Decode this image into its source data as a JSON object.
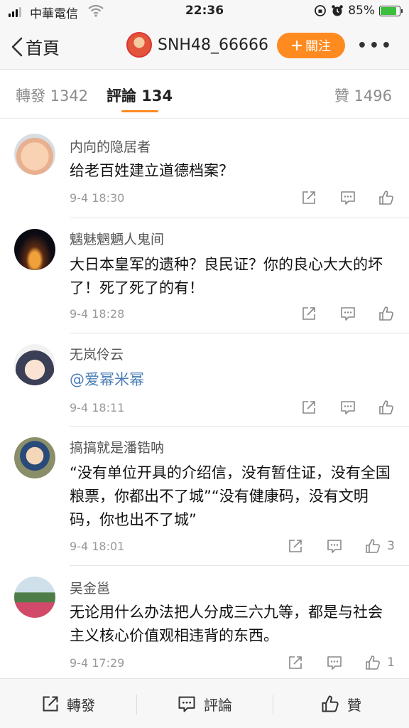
{
  "status_bar": {
    "carrier": "中華電信",
    "time": "22:36",
    "battery": "85%",
    "battery_level": 0.85
  },
  "nav": {
    "back_label": "首頁",
    "username": "SNH48_66666",
    "follow_label": "關注",
    "more_label": "•••"
  },
  "tabs": {
    "repost": "轉發 1342",
    "comments": "評論 134",
    "likes": "贊 1496"
  },
  "comments": [
    {
      "name": "内向的隐居者",
      "text": "给老百姓建立道德档案？",
      "time": "9-4 18:30",
      "likes": "",
      "avatar": "baby-avatar"
    },
    {
      "name": "魑魅魍魉人鬼间",
      "text": "大日本皇军的遗种？良民证？你的良心大大的坏了！死了死了的有！",
      "time": "9-4 18:28",
      "likes": "",
      "avatar": "night-fountain-avatar"
    },
    {
      "name": "无岚伶云",
      "text": "@爱幂米幂",
      "time": "9-4 18:11",
      "likes": "",
      "avatar": "anime-boy-avatar"
    },
    {
      "name": "搞搞就是潘锆呐",
      "text": "“没有单位开具的介绍信，没有暂住证，没有全国粮票，你都出不了城”“没有健康码，没有文明码，你也出不了城”",
      "time": "9-4 18:01",
      "likes": "3",
      "avatar": "cartoon-avatar"
    },
    {
      "name": "吴金邕",
      "text": "无论用什么办法把人分成三六九等，都是与社会主义核心价值观相违背的东西。",
      "time": "9-4 17:29",
      "likes": "1",
      "avatar": "flower-field-avatar"
    }
  ],
  "bottom_bar": {
    "repost": "轉發",
    "comment": "評論",
    "like": "贊"
  },
  "colors": {
    "accent": "#ff8a1f",
    "link": "#4a7db5",
    "muted": "#999999"
  }
}
